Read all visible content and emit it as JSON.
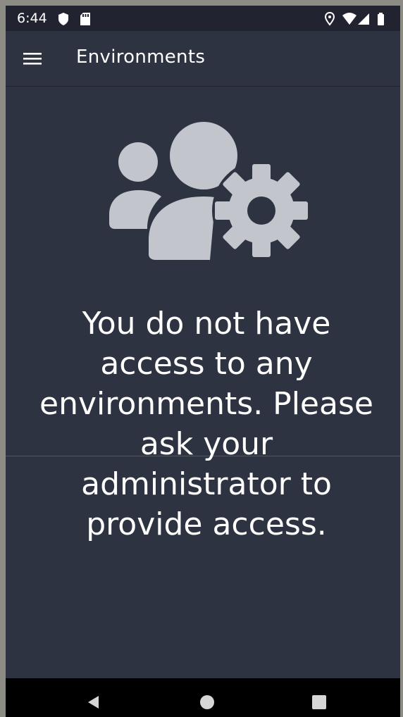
{
  "status_bar": {
    "time": "6:44",
    "left_icons": [
      "shield-icon",
      "sd-card-icon"
    ],
    "right_icons": [
      "location-icon",
      "wifi-icon",
      "signal-icon",
      "battery-icon"
    ]
  },
  "app_bar": {
    "menu_icon": "hamburger-menu-icon",
    "title": "Environments"
  },
  "empty_state": {
    "icon": "users-gear-icon",
    "message": "You do not have access to any environments. Please ask your administrator to provide access."
  },
  "nav_bar": {
    "buttons": [
      "back-icon",
      "home-icon",
      "recents-icon"
    ]
  },
  "colors": {
    "background": "#2e3342",
    "status_bar": "#212430",
    "icon_gray": "#c2c5cc",
    "text": "#ffffff",
    "nav_bar": "#000000"
  }
}
